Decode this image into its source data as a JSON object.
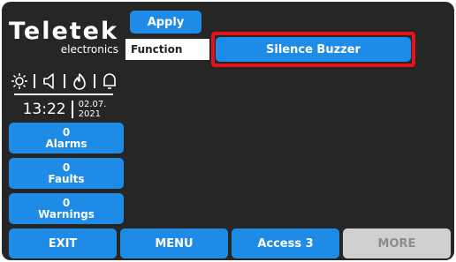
{
  "brand": {
    "name": "Teletek",
    "sub": "electronics"
  },
  "status_icons": [
    "sun-icon",
    "speaker-icon",
    "flame-icon",
    "bell-icon"
  ],
  "clock": {
    "time": "13:22",
    "date_day_month": "02.07.",
    "date_year": "2021"
  },
  "counters": {
    "alarms": {
      "value": "0",
      "label": "Alarms"
    },
    "faults": {
      "value": "0",
      "label": "Faults"
    },
    "warnings": {
      "value": "0",
      "label": "Warnings"
    }
  },
  "top": {
    "apply_label": "Apply",
    "function_label": "Function",
    "function_value": "Silence Buzzer"
  },
  "bottom_bar": {
    "exit": "EXIT",
    "menu": "MENU",
    "access": "Access 3",
    "more": "MORE"
  },
  "colors": {
    "background": "#262626",
    "button": "#1e8ce6",
    "highlight": "#e8101a",
    "disabled": "#d0d0d0"
  }
}
